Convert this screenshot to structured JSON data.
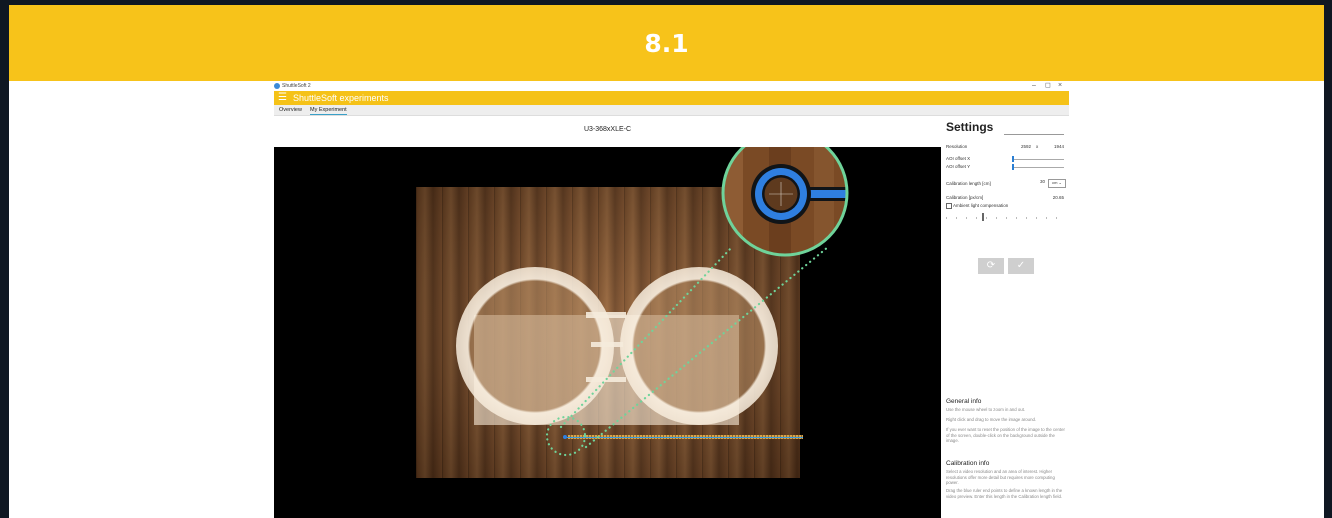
{
  "banner": {
    "title": "8.1",
    "background": "#f7c31a"
  },
  "window": {
    "title": "ShuttleSoft 2",
    "controls": {
      "minimize": "–",
      "maximize": "◻",
      "close": "×"
    }
  },
  "appbar": {
    "menu_icon": "hamburger-icon",
    "title": "ShuttleSoft experiments",
    "color": "#f5c218"
  },
  "tabs": [
    {
      "label": "Overview"
    },
    {
      "label": "My Experiment",
      "active": true
    }
  ],
  "camera": {
    "name": "U3-368xXLE-C"
  },
  "settings": {
    "title": "Settings",
    "resolution": {
      "label": "Resolution",
      "width": "2592",
      "separator": "x",
      "height": "1944"
    },
    "aoi_offset_x": {
      "label": "AOI offset X",
      "value_fraction": 0.0
    },
    "aoi_offset_y": {
      "label": "AOI offset Y",
      "value_fraction": 0.0
    },
    "calibration_length": {
      "label": "Calibration length [cm]",
      "value": "30",
      "unit": "cm"
    },
    "calibration": {
      "label": "Calibration [px/cm]",
      "value": "20.65"
    },
    "ambient_light": {
      "label": "Ambient light compensation",
      "checked": false
    },
    "buttons": {
      "reset": "⟳",
      "confirm": "✓"
    }
  },
  "general_info": {
    "heading": "General info",
    "p1": "Use the mouse wheel to zoom in and out.",
    "p2": "Right click and drag to move the image around.",
    "p3": "If you ever want to reset the position of the image to the center of the screen, double-click on the background outside the image."
  },
  "calibration_info": {
    "heading": "Calibration info",
    "p1": "Select a video resolution and an area of interest. Higher resolutions offer more detail but requires more computing power.",
    "p2": "Drag the blue ruler end points to define a known length in the video preview. Enter this length in the Calibration length field."
  },
  "colors": {
    "accent_green": "#6fd39a",
    "ruler_blue": "#2f7fe0",
    "page_dark": "#0f1722"
  }
}
